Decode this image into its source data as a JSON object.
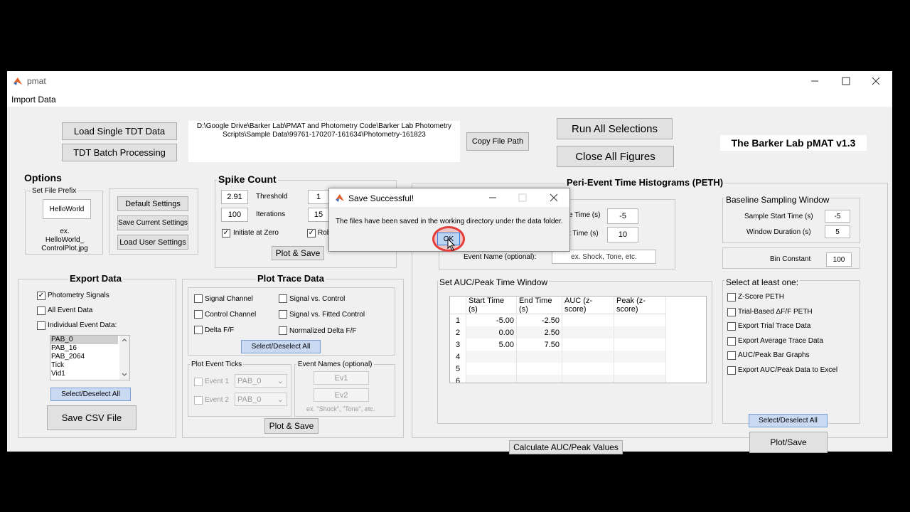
{
  "window": {
    "title": "pmat",
    "menu": "Import Data"
  },
  "top": {
    "load_single": "Load Single TDT Data",
    "batch": "TDT Batch Processing",
    "path": "D:\\Google Drive\\Barker Lab\\PMAT and Photometry Code\\Barker Lab Photometry Scripts\\Sample Data\\99761-170207-161634\\Photometry-161823",
    "copy_path": "Copy File Path",
    "run_all": "Run All Selections",
    "close_all": "Close All Figures",
    "brand": "The Barker Lab pMAT v1.3"
  },
  "options": {
    "title": "Options",
    "prefix_label": "Set File Prefix",
    "prefix_value": "HelloWorld",
    "example": "ex.\nHelloWorld_\nControlPlot.jpg",
    "default": "Default Settings",
    "save": "Save Current Settings",
    "load": "Load User Settings"
  },
  "spike": {
    "title": "Spike Count",
    "threshold_val": "2.91",
    "threshold_label": "Threshold",
    "thr2": "1",
    "iter_val": "100",
    "iter_label": "Iterations",
    "iter2": "15",
    "init_zero": "Initiate at Zero",
    "rob": "Rob",
    "plot_save": "Plot & Save"
  },
  "export": {
    "title": "Export Data",
    "photometry": "Photometry Signals",
    "all_events": "All Event Data",
    "individual": "Individual Event Data:",
    "list": [
      "PAB_0",
      "PAB_16",
      "PAB_2064",
      "Tick",
      "Vid1"
    ],
    "select_all": "Select/Deselect All",
    "save_csv": "Save CSV File"
  },
  "plottrace": {
    "title": "Plot Trace Data",
    "signal": "Signal Channel",
    "control": "Control Channel",
    "delta": "Delta F/F",
    "svc": "Signal vs. Control",
    "svfc": "Signal vs. Fitted Control",
    "norm": "Normalized Delta F/F",
    "select_all": "Select/Deselect All",
    "ticks_title": "Plot Event Ticks",
    "event1": "Event 1",
    "event2": "Event 2",
    "event1_sel": "PAB_0",
    "event2_sel": "PAB_0",
    "names_title": "Event Names (optional)",
    "ev1": "Ev1",
    "ev2": "Ev2",
    "names_hint": "ex. \"Shock\", \"Tone\", etc.",
    "plot_save": "Plot & Save"
  },
  "peth": {
    "title": "Peri-Event Time Histograms (PETH)",
    "start_label": "e Time (s)",
    "start_val": "-5",
    "dur_label": "t Time (s)",
    "dur_val": "10",
    "event_name_label": "Event Name (optional):",
    "event_name_placeholder": "ex. Shock, Tone, etc.",
    "baseline_title": "Baseline Sampling Window",
    "sample_start_label": "Sample Start Time (s)",
    "sample_start_val": "-5",
    "window_dur_label": "Window Duration (s)",
    "window_dur_val": "5",
    "bin_label": "Bin Constant",
    "bin_val": "100",
    "auc_title": "Set AUC/Peak Time Window",
    "columns": [
      "Start Time (s)",
      "End Time (s)",
      "AUC (z-score)",
      "Peak (z-score)"
    ],
    "rows": [
      {
        "n": "1",
        "start": "-5.00",
        "end": "-2.50"
      },
      {
        "n": "2",
        "start": "0.00",
        "end": "2.50"
      },
      {
        "n": "3",
        "start": "5.00",
        "end": "7.50"
      },
      {
        "n": "4",
        "start": "",
        "end": ""
      },
      {
        "n": "5",
        "start": "",
        "end": ""
      },
      {
        "n": "6",
        "start": "",
        "end": ""
      }
    ],
    "calc": "Calculate AUC/Peak Values",
    "select_title": "Select at least one:",
    "opts": [
      "Z-Score PETH",
      "Trial-Based ΔF/F PETH",
      "Export Trial Trace Data",
      "Export Average Trace Data",
      "AUC/Peak Bar Graphs",
      "Export AUC/Peak Data to Excel"
    ],
    "select_all": "Select/Deselect All",
    "plot_save": "Plot/Save"
  },
  "dialog": {
    "title": "Save Successful!",
    "message": "The files have been saved in the working directory under the data folder.",
    "ok": "OK"
  }
}
